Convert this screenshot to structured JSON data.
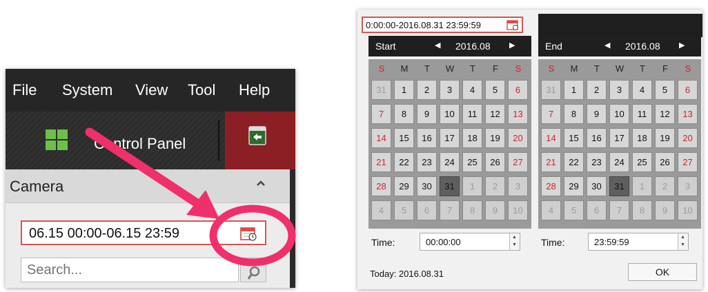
{
  "colors": {
    "accent_red": "#d9534f",
    "annotation_pink": "#f0306a",
    "playback_red": "#8c1f24"
  },
  "left": {
    "menu": [
      "File",
      "System",
      "View",
      "Tool",
      "Help"
    ],
    "toolbar": {
      "control_panel_label": "Control Panel",
      "grid_icon": "grid-icon",
      "playback_icon": "playback-icon"
    },
    "camera_panel": {
      "title": "Camera",
      "collapse_icon": "chevron-up-icon",
      "date_range": "06.15 00:00-06.15 23:59",
      "calendar_icon": "calendar-icon",
      "search_placeholder": "Search...",
      "search_icon": "search-icon"
    }
  },
  "picker": {
    "range": "0:00:00-2016.08.31 23:59:59",
    "weekdays": [
      "S",
      "M",
      "T",
      "W",
      "T",
      "F",
      "S"
    ],
    "start": {
      "label": "Start",
      "month": "2016.08",
      "time_label": "Time:",
      "time": "00:00:00",
      "weeks": [
        [
          "31",
          "1",
          "2",
          "3",
          "4",
          "5",
          "6"
        ],
        [
          "7",
          "8",
          "9",
          "10",
          "11",
          "12",
          "13"
        ],
        [
          "14",
          "15",
          "16",
          "17",
          "18",
          "19",
          "20"
        ],
        [
          "21",
          "22",
          "23",
          "24",
          "25",
          "26",
          "27"
        ],
        [
          "28",
          "29",
          "30",
          "31",
          "1",
          "2",
          "3"
        ],
        [
          "4",
          "5",
          "6",
          "7",
          "8",
          "9",
          "10"
        ]
      ],
      "selected": "31"
    },
    "end": {
      "label": "End",
      "month": "2016.08",
      "time_label": "Time:",
      "time": "23:59:59",
      "weeks": [
        [
          "31",
          "1",
          "2",
          "3",
          "4",
          "5",
          "6"
        ],
        [
          "7",
          "8",
          "9",
          "10",
          "11",
          "12",
          "13"
        ],
        [
          "14",
          "15",
          "16",
          "17",
          "18",
          "19",
          "20"
        ],
        [
          "21",
          "22",
          "23",
          "24",
          "25",
          "26",
          "27"
        ],
        [
          "28",
          "29",
          "30",
          "31",
          "1",
          "2",
          "3"
        ],
        [
          "4",
          "5",
          "6",
          "7",
          "8",
          "9",
          "10"
        ]
      ],
      "selected": "31"
    },
    "today": "Today: 2016.08.31",
    "ok_label": "OK"
  }
}
